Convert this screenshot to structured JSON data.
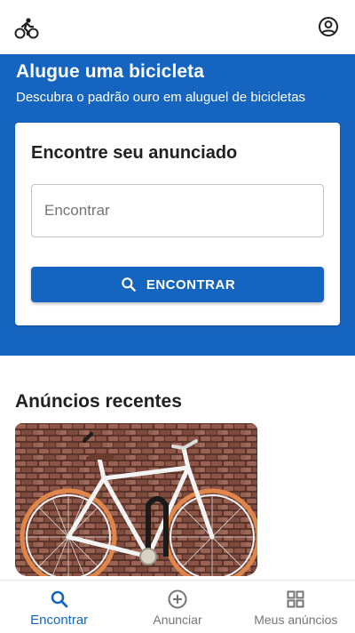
{
  "colors": {
    "primary": "#1565c0",
    "surface": "#ffffff",
    "text": "#212121",
    "muted": "#757575"
  },
  "topbar": {
    "logo_icon": "bike-icon",
    "account_icon": "account-circle-icon"
  },
  "hero": {
    "title": "Alugue uma bicicleta",
    "subtitle": "Descubra o padrão ouro em aluguel de bicicletas"
  },
  "search_card": {
    "title": "Encontre seu anunciado",
    "input": {
      "placeholder": "Encontrar",
      "value": ""
    },
    "button": {
      "label": "ENCONTRAR",
      "icon": "search-icon"
    }
  },
  "recent": {
    "title": "Anúncios recentes",
    "listings": [
      {
        "image": "white-bicycle-against-brick-wall"
      }
    ]
  },
  "bottom_nav": {
    "items": [
      {
        "label": "Encontrar",
        "icon": "search-icon",
        "active": true
      },
      {
        "label": "Anunciar",
        "icon": "add-circle-icon",
        "active": false
      },
      {
        "label": "Meus anúncios",
        "icon": "grid-icon",
        "active": false
      }
    ]
  }
}
